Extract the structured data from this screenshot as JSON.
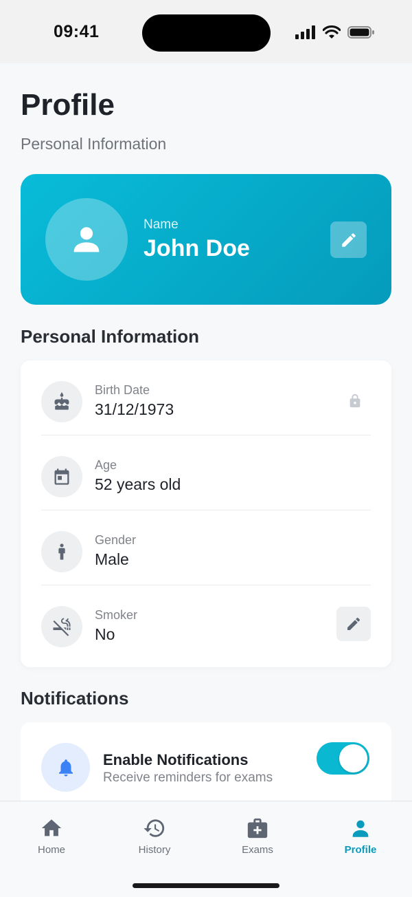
{
  "status_bar": {
    "time": "09:41"
  },
  "header": {
    "title": "Profile",
    "subtitle": "Personal Information"
  },
  "profile_card": {
    "name_label": "Name",
    "name_value": "John Doe",
    "gradient_start": "#08bcd8",
    "gradient_end": "#059bbc"
  },
  "personal_info": {
    "section_title": "Personal Information",
    "rows": [
      {
        "label": "Birth Date",
        "value": "31/12/1973",
        "icon": "cake-icon",
        "action": "lock-icon"
      },
      {
        "label": "Age",
        "value": "52 years old",
        "icon": "calendar-icon",
        "action": null
      },
      {
        "label": "Gender",
        "value": "Male",
        "icon": "person-icon",
        "action": null
      },
      {
        "label": "Smoker",
        "value": "No",
        "icon": "no-smoking-icon",
        "action": "edit-icon"
      }
    ]
  },
  "notifications": {
    "section_title": "Notifications",
    "enable_title": "Enable Notifications",
    "enable_subtitle": "Receive reminders for exams",
    "enabled": true,
    "accent": "#0bb8d2"
  },
  "tab_bar": {
    "tabs": [
      {
        "label": "Home",
        "icon": "home-icon"
      },
      {
        "label": "History",
        "icon": "history-icon"
      },
      {
        "label": "Exams",
        "icon": "medical-kit-icon"
      },
      {
        "label": "Profile",
        "icon": "person-icon",
        "active": true
      }
    ],
    "active_color": "#0a9bbd"
  }
}
